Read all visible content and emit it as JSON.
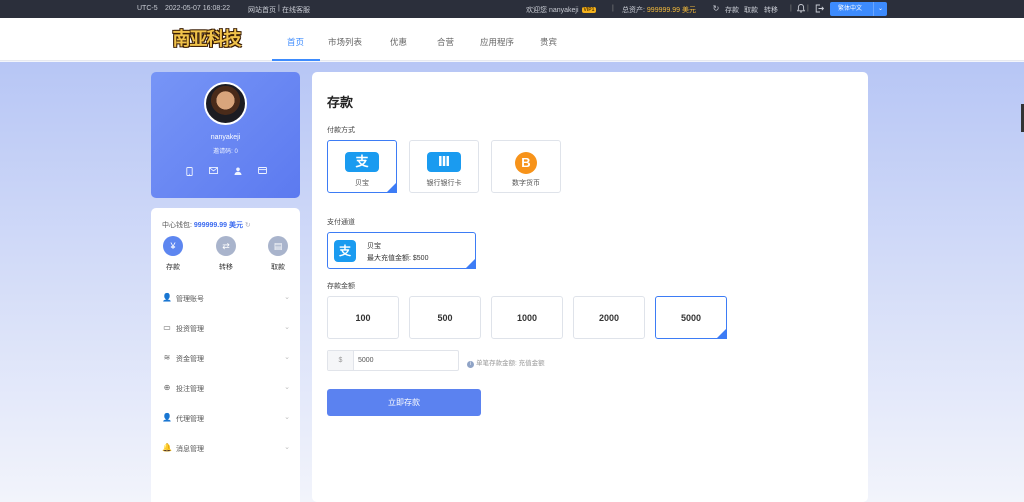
{
  "topbar": {
    "timezone": "UTC-5",
    "datetime": "2022-05-07 16:08:22",
    "site_home": "网站首页",
    "separator": "|",
    "online_service": "在线客服",
    "welcome": "欢迎您 nanyakeji",
    "vip_badge": "VIP1",
    "total_assets_label": "总资产:",
    "total_assets_value": "999999.99 美元",
    "deposit": "存款",
    "withdraw": "取款",
    "transfer": "转移",
    "language": "繁体中文"
  },
  "nav": {
    "logo": "南亚科技",
    "items": [
      "首页",
      "市场列表",
      "优惠",
      "合营",
      "应用程序",
      "贵宾"
    ]
  },
  "profile": {
    "username": "nanyakeji",
    "invite_code": "邀请码: 0"
  },
  "sidebar": {
    "wallet_label": "中心钱包:",
    "wallet_value": "999999.99 美元",
    "actions": [
      "存款",
      "转移",
      "取款"
    ],
    "menu": [
      "管理账号",
      "投资管理",
      "资金管理",
      "投注管理",
      "代理管理",
      "消息管理"
    ]
  },
  "deposit": {
    "title": "存款",
    "pay_method_label": "付款方式",
    "pay_methods": [
      "贝宝",
      "银行银行卡",
      "数字货币"
    ],
    "channel_label": "支付通道",
    "channel_name": "贝宝",
    "channel_max": "最大充值金额: $500",
    "amount_label": "存款金额",
    "amounts": [
      "100",
      "500",
      "1000",
      "2000",
      "5000"
    ],
    "currency_symbol": "$",
    "amount_value": "5000",
    "hint": "单笔存款金额: 充值金额",
    "submit": "立即存款"
  },
  "colors": {
    "accent": "#3d8bfd",
    "topbar": "#2b2f3b",
    "profile_card": "#6886f3",
    "gold": "#f2b93b"
  }
}
